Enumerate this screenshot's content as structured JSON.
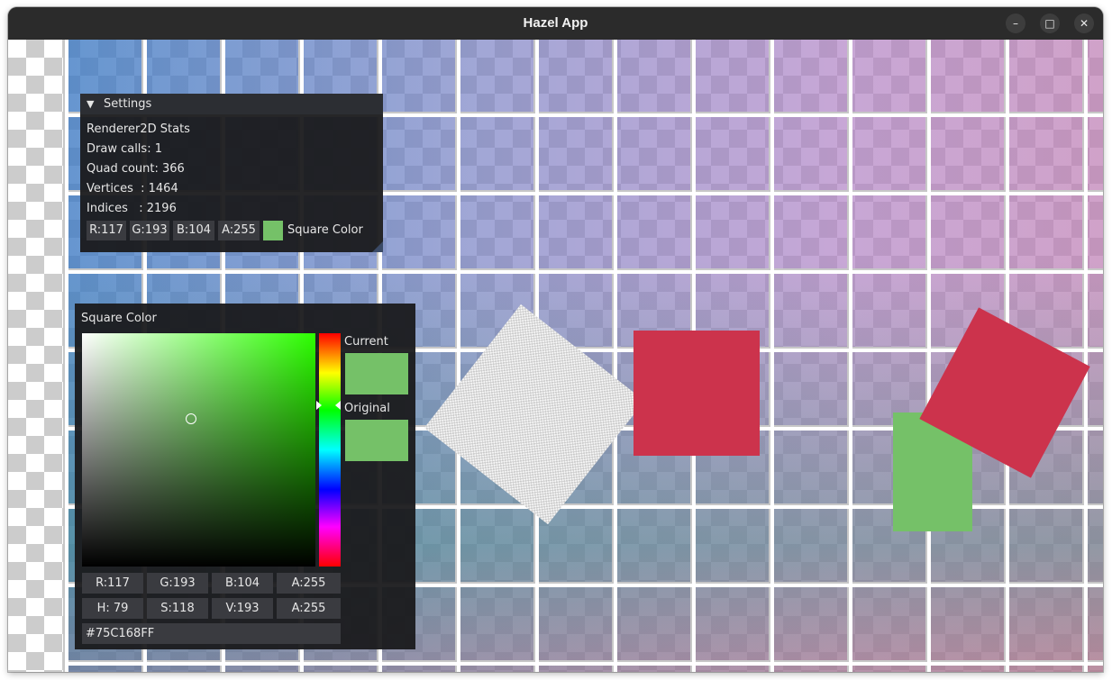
{
  "window": {
    "title": "Hazel App",
    "controls": {
      "minimize": "–",
      "maximize": "□",
      "close": "✕"
    }
  },
  "colors": {
    "square_color": "#75C168",
    "red_square": "#CC334C",
    "titlebar": "#2B2B2B"
  },
  "settings": {
    "header": "Settings",
    "collapse_icon": "▼",
    "stats_title": "Renderer2D Stats",
    "draw_calls": "Draw calls: 1",
    "quad_count": "Quad count: 366",
    "vertices": "Vertices  : 1464",
    "indices": "Indices   : 2196",
    "rgba": {
      "r": "R:117",
      "g": "G:193",
      "b": "B:104",
      "a": "A:255"
    },
    "color_label": "Square Color"
  },
  "picker": {
    "title": "Square Color",
    "current_label": "Current",
    "original_label": "Original",
    "rgba": {
      "r": "R:117",
      "g": "G:193",
      "b": "B:104",
      "a": "A:255"
    },
    "hsva": {
      "h": "H: 79",
      "s": "S:118",
      "v": "V:193",
      "a": "A:255"
    },
    "hex": "#75C168FF"
  }
}
